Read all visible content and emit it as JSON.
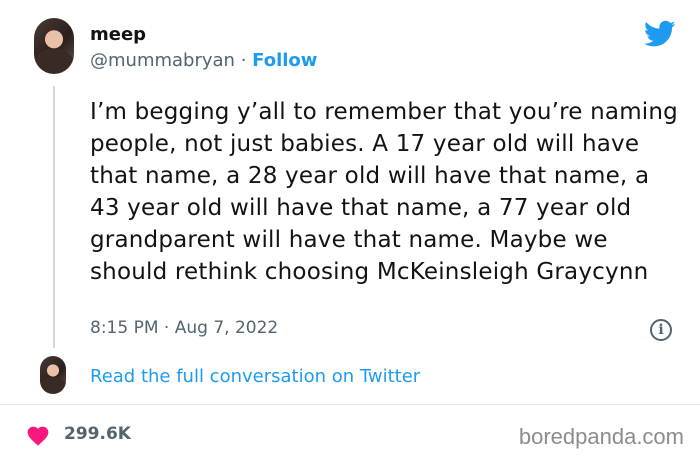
{
  "author": {
    "display_name": "meep",
    "handle": "@mummabryan",
    "separator": " · ",
    "follow_label": "Follow"
  },
  "tweet": {
    "text": "I’m begging y’all to remember that you’re naming people, not just babies. A 17 year old will have that name, a 28 year old will have that name, a 43 year old will have that name, a 77 year old grandparent will have that name. Maybe we should rethink choosing McKeinsleigh Graycynn",
    "time": "8:15 PM",
    "date_separator": " · ",
    "date": "Aug 7, 2022"
  },
  "read_more_label": "Read the full conversation on Twitter",
  "likes_count": "299.6K",
  "watermark": "boredpanda.com",
  "icons": {
    "brand": "twitter-bird-icon",
    "info": "info-icon",
    "like": "heart-icon"
  },
  "colors": {
    "link_blue": "#1d9bf0",
    "heart_red": "#f91880",
    "muted": "#536471"
  }
}
